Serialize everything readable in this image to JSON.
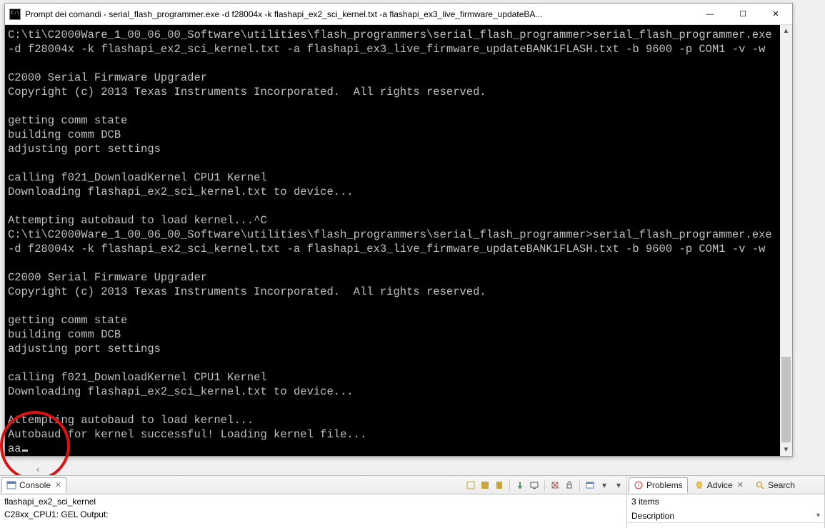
{
  "window": {
    "title": "Prompt dei comandi - serial_flash_programmer.exe  -d f28004x -k flashapi_ex2_sci_kernel.txt -a flashapi_ex3_live_firmware_updateBA...",
    "minimize": "—",
    "maximize": "☐",
    "close": "✕"
  },
  "terminal": {
    "text": "C:\\ti\\C2000Ware_1_00_06_00_Software\\utilities\\flash_programmers\\serial_flash_programmer>serial_flash_programmer.exe -d f28004x -k flashapi_ex2_sci_kernel.txt -a flashapi_ex3_live_firmware_updateBANK1FLASH.txt -b 9600 -p COM1 -v -w\n\nC2000 Serial Firmware Upgrader\nCopyright (c) 2013 Texas Instruments Incorporated.  All rights reserved.\n\ngetting comm state\nbuilding comm DCB\nadjusting port settings\n\ncalling f021_DownloadKernel CPU1 Kernel\nDownloading flashapi_ex2_sci_kernel.txt to device...\n\nAttempting autobaud to load kernel...^C\nC:\\ti\\C2000Ware_1_00_06_00_Software\\utilities\\flash_programmers\\serial_flash_programmer>serial_flash_programmer.exe -d f28004x -k flashapi_ex2_sci_kernel.txt -a flashapi_ex3_live_firmware_updateBANK1FLASH.txt -b 9600 -p COM1 -v -w\n\nC2000 Serial Firmware Upgrader\nCopyright (c) 2013 Texas Instruments Incorporated.  All rights reserved.\n\ngetting comm state\nbuilding comm DCB\nadjusting port settings\n\ncalling f021_DownloadKernel CPU1 Kernel\nDownloading flashapi_ex2_sci_kernel.txt to device...\n\nAttempting autobaud to load kernel...\nAutobaud for kernel successful! Loading kernel file...\naa"
  },
  "console": {
    "tab_label": "Console",
    "line1": "flashapi_ex2_sci_kernel",
    "line2": "C28xx_CPU1: GEL Output:"
  },
  "problems": {
    "tab_problems": "Problems",
    "tab_advice": "Advice",
    "tab_search": "Search",
    "summary": "3 items",
    "col_description": "Description"
  }
}
